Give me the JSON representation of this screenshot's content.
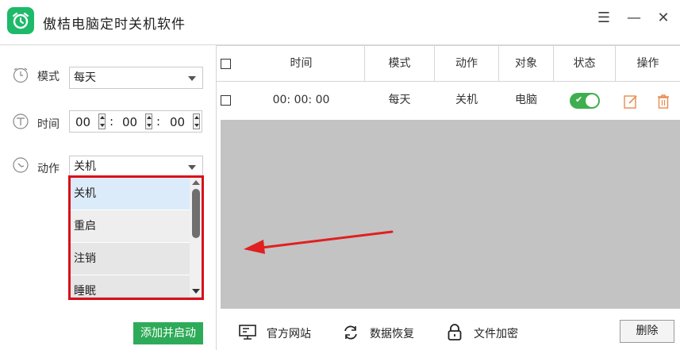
{
  "app": {
    "title": "傲桔电脑定时关机软件"
  },
  "window_controls": {
    "menu": "☰",
    "minimize": "—",
    "close": "✕"
  },
  "form": {
    "mode_label": "模式",
    "mode_value": "每天",
    "time_label": "时间",
    "time_hour": "00",
    "time_minute": "00",
    "time_second": "00",
    "time_sep": ":",
    "action_label": "动作",
    "action_value": "关机",
    "action_options": [
      "关机",
      "重启",
      "注销",
      "睡眠"
    ],
    "action_selected_index": 0,
    "add_button": "添加并启动"
  },
  "table": {
    "headers": [
      "时间",
      "模式",
      "动作",
      "对象",
      "状态",
      "操作"
    ],
    "rows": [
      {
        "time": "00: 00: 00",
        "mode": "每天",
        "action": "关机",
        "target": "电脑",
        "enabled": true
      }
    ]
  },
  "bottom": {
    "website": "官方网站",
    "recover": "数据恢复",
    "encrypt": "文件加密",
    "delete": "删除"
  },
  "colors": {
    "accent_green": "#2eab58",
    "highlight_red": "#d9101a",
    "annotation_arrow": "#e02020",
    "action_icon_orange": "#e98a50"
  }
}
